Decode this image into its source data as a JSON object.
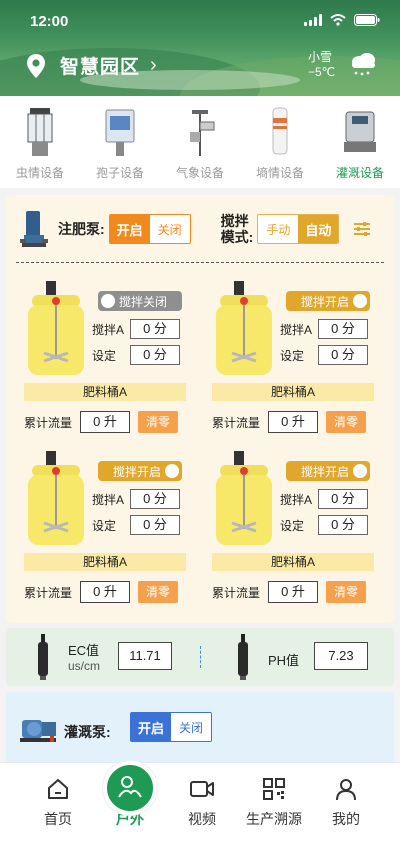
{
  "status": {
    "time": "12:00"
  },
  "header": {
    "location": "智慧园区",
    "weather_desc": "小雪",
    "temperature": "−5℃"
  },
  "device_tabs": [
    {
      "label": "虫情设备",
      "active": false
    },
    {
      "label": "孢子设备",
      "active": false
    },
    {
      "label": "气象设备",
      "active": false
    },
    {
      "label": "墒情设备",
      "active": false
    },
    {
      "label": "灌溉设备",
      "active": true
    }
  ],
  "fert_pump": {
    "label": "注肥泵:",
    "on_label": "开启",
    "off_label": "关闭",
    "state": "on"
  },
  "stir_mode": {
    "label_line1": "搅拌",
    "label_line2": "模式:",
    "manual_label": "手动",
    "auto_label": "自动",
    "state": "auto"
  },
  "tanks": [
    {
      "toggle_label": "搅拌关闭",
      "toggle_on": false,
      "stir_label": "搅拌A",
      "stir_value": "0 分",
      "set_label": "设定",
      "set_value": "0 分",
      "name": "肥料桶A",
      "flow_label": "累计流量",
      "flow_value": "0 升",
      "clear_label": "清零"
    },
    {
      "toggle_label": "搅拌开启",
      "toggle_on": true,
      "stir_label": "搅拌A",
      "stir_value": "0 分",
      "set_label": "设定",
      "set_value": "0 分",
      "name": "肥料桶A",
      "flow_label": "累计流量",
      "flow_value": "0 升",
      "clear_label": "清零"
    },
    {
      "toggle_label": "搅拌开启",
      "toggle_on": true,
      "stir_label": "搅拌A",
      "stir_value": "0 分",
      "set_label": "设定",
      "set_value": "0 分",
      "name": "肥料桶A",
      "flow_label": "累计流量",
      "flow_value": "0 升",
      "clear_label": "清零"
    },
    {
      "toggle_label": "搅拌开启",
      "toggle_on": true,
      "stir_label": "搅拌A",
      "stir_value": "0 分",
      "set_label": "设定",
      "set_value": "0 分",
      "name": "肥料桶A",
      "flow_label": "累计流量",
      "flow_value": "0 升",
      "clear_label": "清零"
    }
  ],
  "sensors": {
    "ec_label": "EC值",
    "ec_unit": "us/cm",
    "ec_value": "11.71",
    "ph_label": "PH值",
    "ph_value": "7.23"
  },
  "irrigation_pump": {
    "label": "灌溉泵:",
    "on_label": "开启",
    "off_label": "关闭",
    "state": "on"
  },
  "nav": [
    {
      "label": "首页",
      "icon": "home-icon",
      "active": false
    },
    {
      "label": "户外",
      "icon": "outdoor-icon",
      "active": true
    },
    {
      "label": "视频",
      "icon": "video-icon",
      "active": false
    },
    {
      "label": "生产溯源",
      "icon": "qrcode-icon",
      "active": false
    },
    {
      "label": "我的",
      "icon": "user-icon",
      "active": false
    }
  ],
  "colors": {
    "brand_green": "#1e9a55",
    "orange": "#f08a1c",
    "gold": "#e0a72c",
    "blue": "#3a72d6"
  }
}
